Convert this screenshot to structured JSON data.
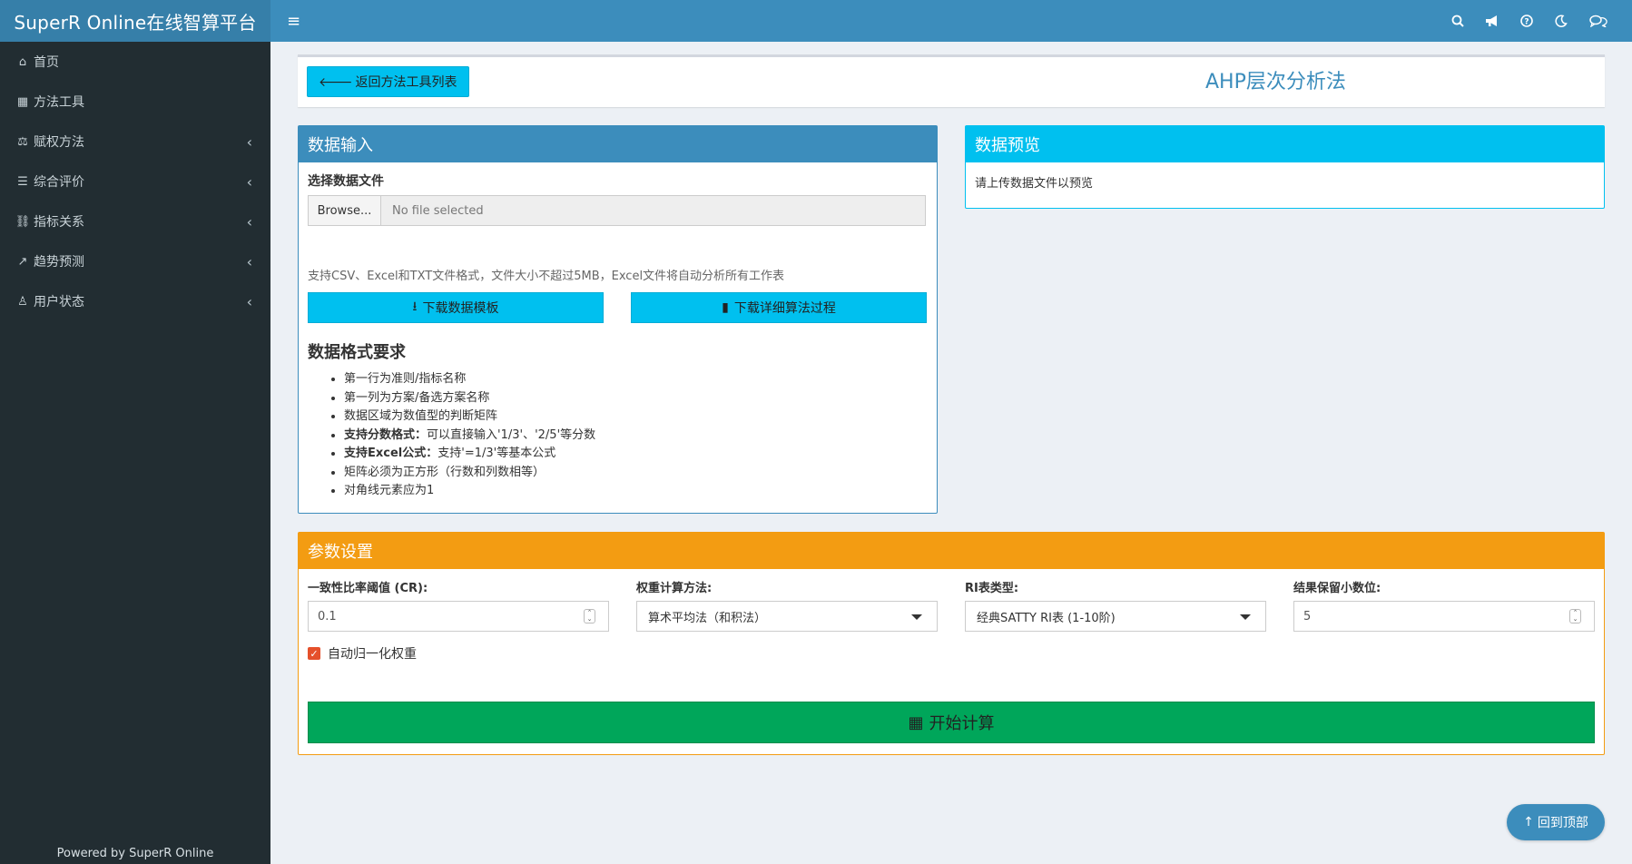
{
  "header": {
    "brand": "SuperR Online在线智算平台",
    "toggle_icon": "≡",
    "icons": [
      "search-icon",
      "bullhorn-icon",
      "question-icon",
      "moon-icon",
      "comments-icon"
    ]
  },
  "sidebar": {
    "items": [
      {
        "label": "首页",
        "icon": "home-icon",
        "glyph": "⌂",
        "chevron": false
      },
      {
        "label": "方法工具",
        "icon": "table-icon",
        "glyph": "▦",
        "chevron": false
      },
      {
        "label": "赋权方法",
        "icon": "balance-scale-icon",
        "glyph": "⚖",
        "chevron": true
      },
      {
        "label": "综合评价",
        "icon": "list-icon",
        "glyph": "☰",
        "chevron": true
      },
      {
        "label": "指标关系",
        "icon": "link-icon",
        "glyph": "⛓",
        "chevron": true
      },
      {
        "label": "趋势预测",
        "icon": "line-chart-icon",
        "glyph": "↗",
        "chevron": true
      },
      {
        "label": "用户状态",
        "icon": "user-icon",
        "glyph": "♙",
        "chevron": true
      }
    ],
    "footer": "Powered by SuperR Online"
  },
  "title_box": {
    "back_label": "返回方法工具列表",
    "title": "AHP层次分析法"
  },
  "input_box": {
    "header": "数据输入",
    "file_label": "选择数据文件",
    "browse_label": "Browse...",
    "file_placeholder": "No file selected",
    "hint": "支持CSV、Excel和TXT文件格式，文件大小不超过5MB，Excel文件将自动分析所有工作表",
    "download_template": "下载数据模板",
    "download_process": "下载详细算法过程",
    "requirements_title": "数据格式要求",
    "requirements": [
      {
        "bold": "",
        "text": "第一行为准则/指标名称"
      },
      {
        "bold": "",
        "text": "第一列为方案/备选方案名称"
      },
      {
        "bold": "",
        "text": "数据区域为数值型的判断矩阵"
      },
      {
        "bold": "支持分数格式：",
        "text": "可以直接输入'1/3'、'2/5'等分数"
      },
      {
        "bold": "支持Excel公式：",
        "text": "支持'=1/3'等基本公式"
      },
      {
        "bold": "",
        "text": "矩阵必须为正方形（行数和列数相等）"
      },
      {
        "bold": "",
        "text": "对角线元素应为1"
      }
    ]
  },
  "preview_box": {
    "header": "数据预览",
    "text": "请上传数据文件以预览"
  },
  "params_box": {
    "header": "参数设置",
    "cr_label": "一致性比率阈值 (CR):",
    "cr_value": "0.1",
    "method_label": "权重计算方法:",
    "method_value": "算术平均法（和积法）",
    "ri_label": "RI表类型:",
    "ri_value": "经典SATTY RI表 (1-10阶)",
    "decimals_label": "结果保留小数位:",
    "decimals_value": "5",
    "normalize_label": "自动归一化权重",
    "normalize_checked": true,
    "run_label": "开始计算"
  },
  "back_to_top": "回到顶部",
  "colors": {
    "primary": "#3c8dbc",
    "info": "#00c0ef",
    "warning": "#f39c12",
    "success": "#00a65a",
    "sidebar": "#222d32"
  }
}
